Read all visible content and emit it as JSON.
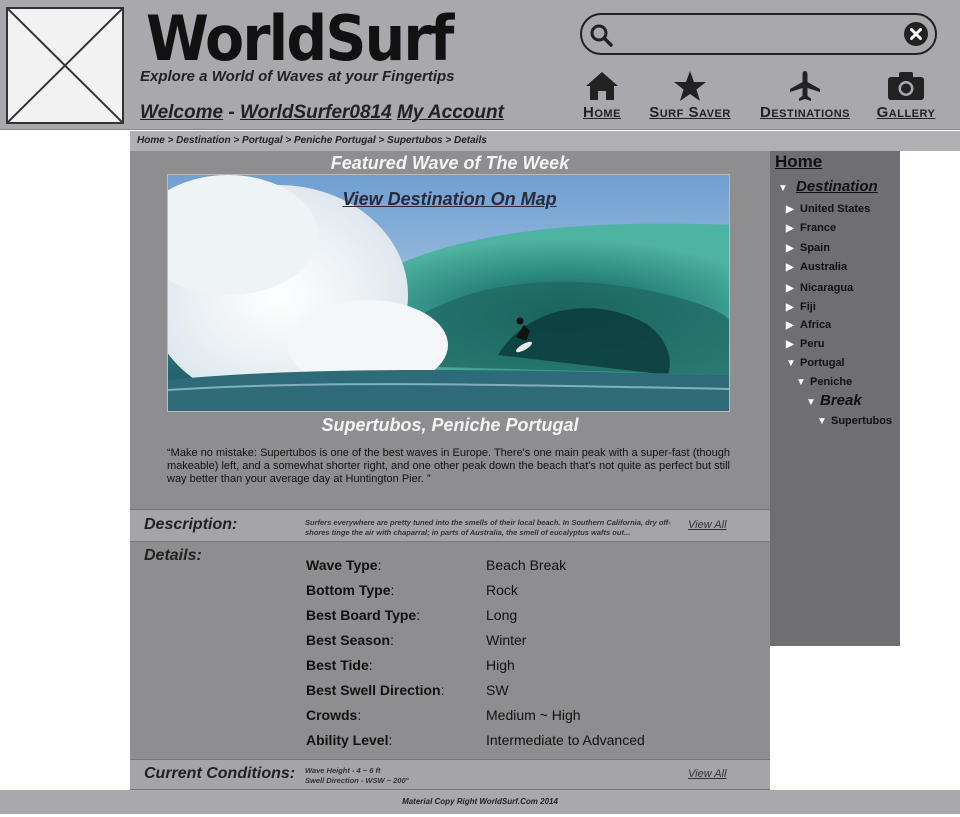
{
  "header": {
    "site_title": "WorldSurf",
    "tagline": "Explore a World of Waves at your Fingertips",
    "welcome_prefix": "Welcome",
    "welcome_sep": "-",
    "username": "WorldSurfer0814",
    "account_link": "My Account",
    "search": {
      "placeholder": "",
      "value": ""
    },
    "nav": [
      {
        "label": "Home",
        "icon": "home-icon"
      },
      {
        "label": "Surf Saver",
        "icon": "star-icon"
      },
      {
        "label": "Destinations",
        "icon": "airplane-icon"
      },
      {
        "label": "Gallery",
        "icon": "camera-icon"
      }
    ]
  },
  "breadcrumb": "Home > Destination > Portugal > Peniche Portugal > Supertubos > Details",
  "featured": {
    "title": "Featured Wave of The Week",
    "map_link": "View Destination On Map",
    "caption": "Supertubos, Peniche Portugal",
    "quote": "“Make no mistake: Supertubos is one of the best waves in Europe. There's one main peak with a super-fast (though makeable) left, and a somewhat shorter right, and one other peak down the beach that's not quite as perfect but still way better than your average day at Huntington Pier. ”"
  },
  "description": {
    "label": "Description:",
    "text": "Surfers everywhere are pretty tuned into the smells of their local beach. In Southern California, dry off-shores tinge the air with chaparral; in parts of Australia, the smell of eucalyptus wafts out...",
    "view_all": "View All"
  },
  "details": {
    "label": "Details:",
    "rows": [
      {
        "key": "Wave Type",
        "value": "Beach Break"
      },
      {
        "key": "Bottom Type",
        "value": "Rock"
      },
      {
        "key": "Best Board Type",
        "value": "Long"
      },
      {
        "key": "Best Season",
        "value": "Winter"
      },
      {
        "key": "Best Tide",
        "value": "High"
      },
      {
        "key": "Best Swell Direction",
        "value": "SW"
      },
      {
        "key": "Crowds",
        "value": "Medium ~ High"
      },
      {
        "key": "Ability Level",
        "value": "Intermediate to Advanced"
      }
    ]
  },
  "conditions": {
    "label": "Current Conditions:",
    "line1": "Wave Height - 4 ~ 6 ft",
    "line2": "Swell Direction - WSW ~ 200°",
    "view_all": "View All"
  },
  "sidebar": {
    "home": "Home",
    "destination": "Destination",
    "countries": [
      "United States",
      "France",
      "Spain",
      "Australia",
      "Nicaragua",
      "Fiji",
      "Africa",
      "Peru",
      "Portugal"
    ],
    "region": "Peniche",
    "category": "Break",
    "spot": "Supertubos"
  },
  "footer": "Material Copy Right WorldSurf.Com 2014"
}
